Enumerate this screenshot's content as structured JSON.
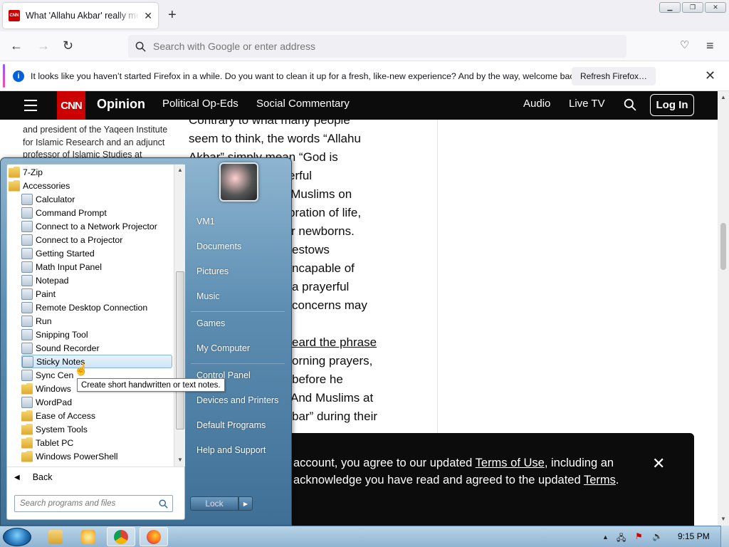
{
  "browser": {
    "tab_title": "What 'Allahu Akbar' really means",
    "favicon_text": "CNN",
    "tab_close": "✕",
    "new_tab": "+",
    "url_placeholder": "Search with Google or enter address",
    "notification": {
      "text": "It looks like you haven’t started Firefox in a while. Do you want to clean it up for a fresh, like-new experience? And by the way, welcome back!",
      "button": "Refresh Firefox…",
      "close": "✕"
    }
  },
  "cnn": {
    "logo": "CNN",
    "section": "Opinion",
    "nav": [
      "Political Op-Eds",
      "Social Commentary"
    ],
    "right": [
      "Audio",
      "Live TV"
    ],
    "login": "Log In"
  },
  "article": {
    "bio": [
      "and president of the Yaqeen Institute",
      "for Islamic Research and an adjunct",
      "professor of Islamic Studies at"
    ],
    "lines": [
      "Contrary to what many people",
      "seem to think, the words “Allahu",
      "Akbar” simply mean “God is",
      "erful",
      "y Muslims on",
      "bration of life,",
      "r newborns.",
      "estows",
      "ncapable of",
      "a prayerful",
      "concerns may",
      "",
      "eard the phrase",
      "orning prayers,",
      "before he",
      "And Muslims at",
      "bar” during their"
    ]
  },
  "cookie_banner": {
    "line1_pre": "account, you agree to our updated ",
    "line1_link": "Terms of Use",
    "line1_post": ", including an",
    "line2_pre": "acknowledge you have read and agreed to the updated ",
    "line2_link": "Terms",
    "line2_post": ".",
    "close": "✕"
  },
  "start_menu": {
    "programs": [
      {
        "label": "7-Zip",
        "type": "folder",
        "indent": 0
      },
      {
        "label": "Accessories",
        "type": "folder",
        "indent": 0
      },
      {
        "label": "Calculator",
        "type": "app",
        "indent": 1
      },
      {
        "label": "Command Prompt",
        "type": "app",
        "indent": 1
      },
      {
        "label": "Connect to a Network Projector",
        "type": "app",
        "indent": 1
      },
      {
        "label": "Connect to a Projector",
        "type": "app",
        "indent": 1
      },
      {
        "label": "Getting Started",
        "type": "app",
        "indent": 1
      },
      {
        "label": "Math Input Panel",
        "type": "app",
        "indent": 1
      },
      {
        "label": "Notepad",
        "type": "app",
        "indent": 1
      },
      {
        "label": "Paint",
        "type": "app",
        "indent": 1
      },
      {
        "label": "Remote Desktop Connection",
        "type": "app",
        "indent": 1
      },
      {
        "label": "Run",
        "type": "app",
        "indent": 1
      },
      {
        "label": "Snipping Tool",
        "type": "app",
        "indent": 1
      },
      {
        "label": "Sound Recorder",
        "type": "app",
        "indent": 1
      },
      {
        "label": "Sticky Notes",
        "type": "app",
        "indent": 1,
        "highlighted": true
      },
      {
        "label": "Sync Cen",
        "type": "app",
        "indent": 1
      },
      {
        "label": "Windows",
        "type": "folder",
        "indent": 1
      },
      {
        "label": "WordPad",
        "type": "app",
        "indent": 1
      },
      {
        "label": "Ease of Access",
        "type": "folder",
        "indent": 1
      },
      {
        "label": "System Tools",
        "type": "folder",
        "indent": 1
      },
      {
        "label": "Tablet PC",
        "type": "folder",
        "indent": 1
      },
      {
        "label": "Windows PowerShell",
        "type": "folder",
        "indent": 1
      }
    ],
    "back_label": "Back",
    "search_placeholder": "Search programs and files",
    "right_items": [
      "VM1",
      "Documents",
      "Pictures",
      "Music",
      "Games",
      "My Computer",
      "Control Panel",
      "Devices and Printers",
      "Default Programs",
      "Help and Support"
    ],
    "lock_label": "Lock",
    "tooltip": "Create short handwritten or text notes."
  },
  "taskbar": {
    "clock": "9:15 PM"
  }
}
